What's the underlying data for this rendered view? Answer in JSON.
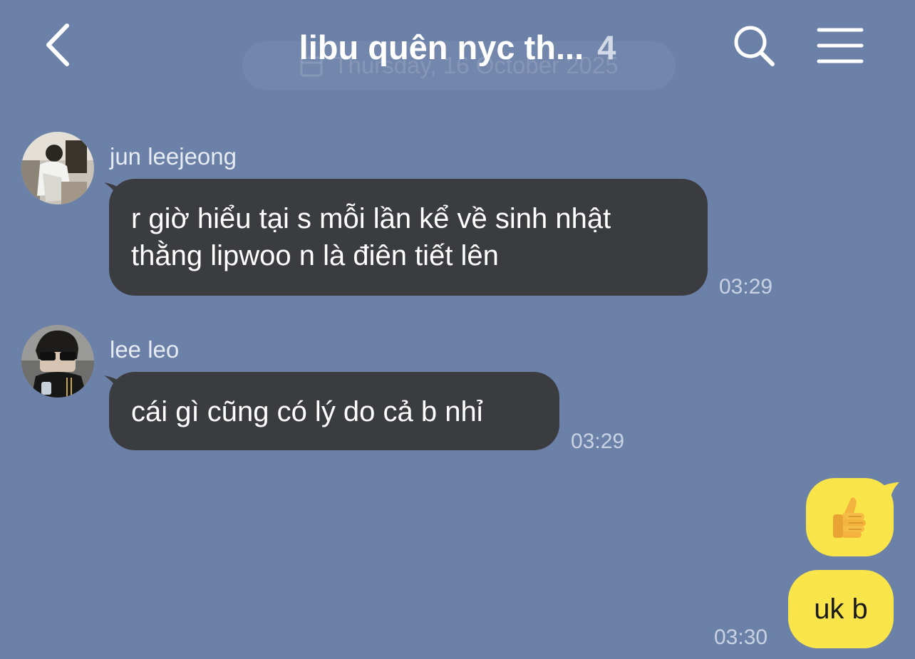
{
  "header": {
    "back_icon": "chevron-left-icon",
    "title": "libu quên nyc th...",
    "member_count": "4",
    "date_hint": "Thursday, 16 October 2025",
    "search_icon": "search-icon",
    "menu_icon": "hamburger-menu-icon"
  },
  "messages": [
    {
      "sender": "jun leejeong",
      "text": "r giờ hiểu tại s mỗi lần kể về sinh nhật\nthằng lipwoo n là điên tiết lên",
      "time": "03:29",
      "outgoing": false
    },
    {
      "sender": "lee leo",
      "text": "cái gì cũng có lý do cả b nhỉ",
      "time": "03:29",
      "outgoing": false
    },
    {
      "sender": "",
      "sticker": "thumbs-up-emoji",
      "text": "👍",
      "time": "",
      "outgoing": true
    },
    {
      "sender": "",
      "text": "uk b",
      "time": "03:30",
      "outgoing": true
    }
  ],
  "colors": {
    "background": "#6c81a8",
    "incoming_bubble": "#3b3c40",
    "outgoing_bubble": "#f9e44a",
    "timestamp": "#c9d2e3"
  }
}
